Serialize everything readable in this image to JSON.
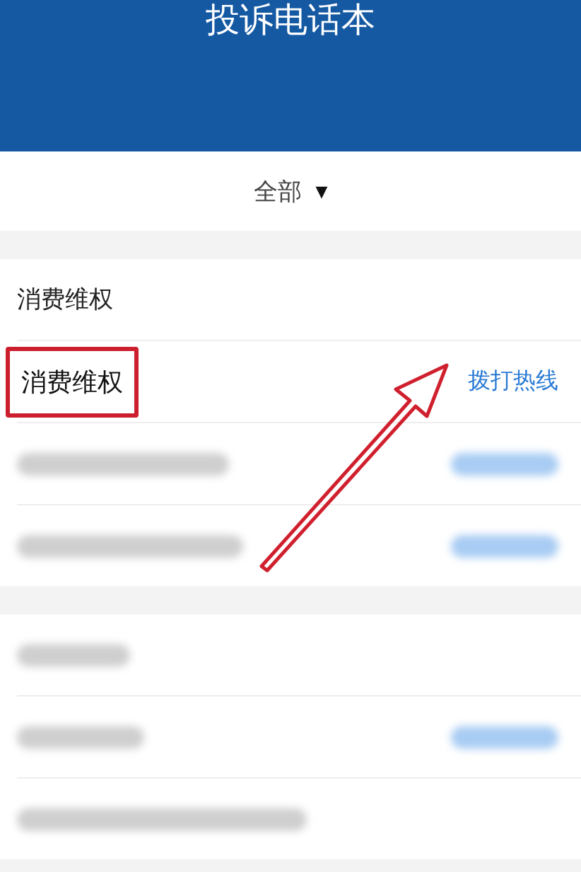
{
  "header": {
    "title": "投诉电话本"
  },
  "filter": {
    "label": "全部",
    "caret": "▼"
  },
  "sections": [
    {
      "heading": {
        "kind": "text",
        "text": "消费维权"
      },
      "rows": [
        {
          "kind": "text",
          "name": "消费维权",
          "action": "拨打热线",
          "highlighted": true
        },
        {
          "kind": "redacted"
        },
        {
          "kind": "redacted"
        }
      ]
    },
    {
      "heading": {
        "kind": "redacted"
      },
      "rows": [
        {
          "kind": "redacted"
        },
        {
          "kind": "redacted-plain"
        }
      ]
    }
  ],
  "annotation": {
    "kind": "arrow"
  }
}
